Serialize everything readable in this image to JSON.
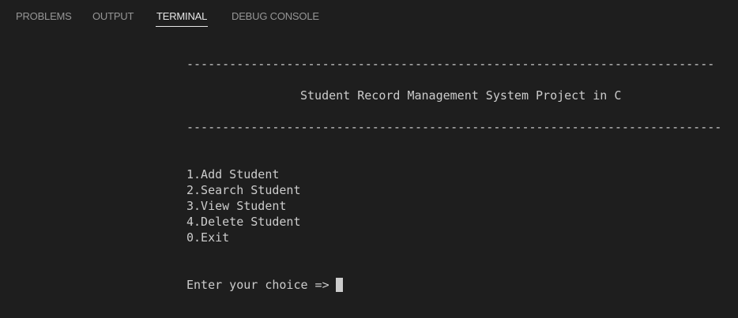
{
  "tabs": {
    "problems": "PROBLEMS",
    "output": "OUTPUT",
    "terminal": "TERMINAL",
    "debug_console": "DEBUG CONSOLE",
    "active": "TERMINAL"
  },
  "terminal": {
    "divider_top": "--------------------------------------------------------------------------",
    "title": "Student Record Management System Project in C",
    "divider_bottom": "---------------------------------------------------------------------------",
    "menu": [
      "1.Add Student",
      "2.Search Student",
      "3.View Student",
      "4.Delete Student",
      "0.Exit"
    ],
    "prompt": "Enter your choice =>"
  },
  "colors": {
    "background": "#1e1e1e",
    "text": "#cccccc",
    "tab_inactive": "#969696",
    "tab_active": "#e7e7e7"
  }
}
